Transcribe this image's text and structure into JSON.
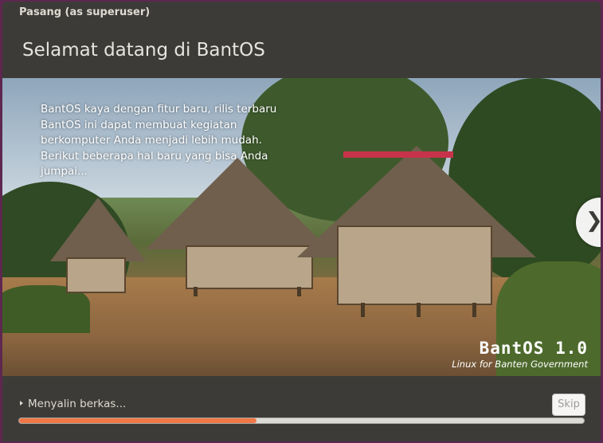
{
  "window": {
    "title": "Pasang (as superuser)"
  },
  "header": {
    "heading": "Selamat datang di BantOS"
  },
  "slide": {
    "text": "BantOS kaya dengan fitur baru, rilis terbaru BantOS ini dapat membuat kegiatan berkomputer Anda menjadi lebih mudah. Berikut beberapa hal baru yang bisa Anda jumpai...",
    "logo_name": "BantOS 1.0",
    "logo_subtitle": "Linux for Banten Government",
    "next_icon": "chevron-right-icon"
  },
  "footer": {
    "status": "Menyalin berkas...",
    "skip_label": "Skip",
    "progress_fraction": 0.42
  },
  "colors": {
    "accent": "#f07746",
    "chrome": "#3c3b37",
    "desktop": "#5e2750"
  }
}
